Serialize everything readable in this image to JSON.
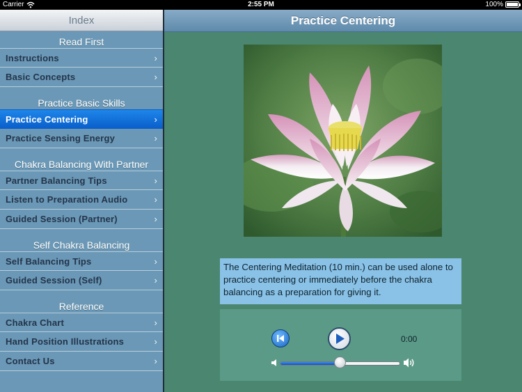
{
  "status_bar": {
    "carrier": "Carrier",
    "time": "2:55 PM",
    "battery": "100%"
  },
  "sidebar": {
    "title": "Index",
    "sections": [
      {
        "title": "Read First",
        "items": [
          {
            "label": "Instructions"
          },
          {
            "label": "Basic Concepts"
          }
        ]
      },
      {
        "title": "Practice Basic Skills",
        "items": [
          {
            "label": "Practice Centering",
            "selected": true
          },
          {
            "label": "Practice Sensing Energy"
          }
        ]
      },
      {
        "title": "Chakra Balancing With Partner",
        "items": [
          {
            "label": "Partner Balancing Tips"
          },
          {
            "label": "Listen to Preparation Audio"
          },
          {
            "label": "Guided Session (Partner)"
          }
        ]
      },
      {
        "title": "Self Chakra Balancing",
        "items": [
          {
            "label": "Self Balancing Tips"
          },
          {
            "label": "Guided Session (Self)"
          }
        ]
      },
      {
        "title": "Reference",
        "items": [
          {
            "label": "Chakra Chart"
          },
          {
            "label": "Hand Position Illustrations"
          },
          {
            "label": "Contact Us"
          }
        ]
      }
    ],
    "chevron": "›"
  },
  "main": {
    "title": "Practice Centering",
    "description": "The Centering Meditation (10 min.) can be used alone to practice centering or immediately before the chakra balancing as a preparation for giving it.",
    "player": {
      "elapsed": "0:00",
      "volume_fraction": 0.5
    }
  },
  "colors": {
    "selected": "#1a7ce0",
    "sidebar_bg": "#6a98b6",
    "main_bg": "#4b8670",
    "description_bg": "#89c2e6"
  }
}
